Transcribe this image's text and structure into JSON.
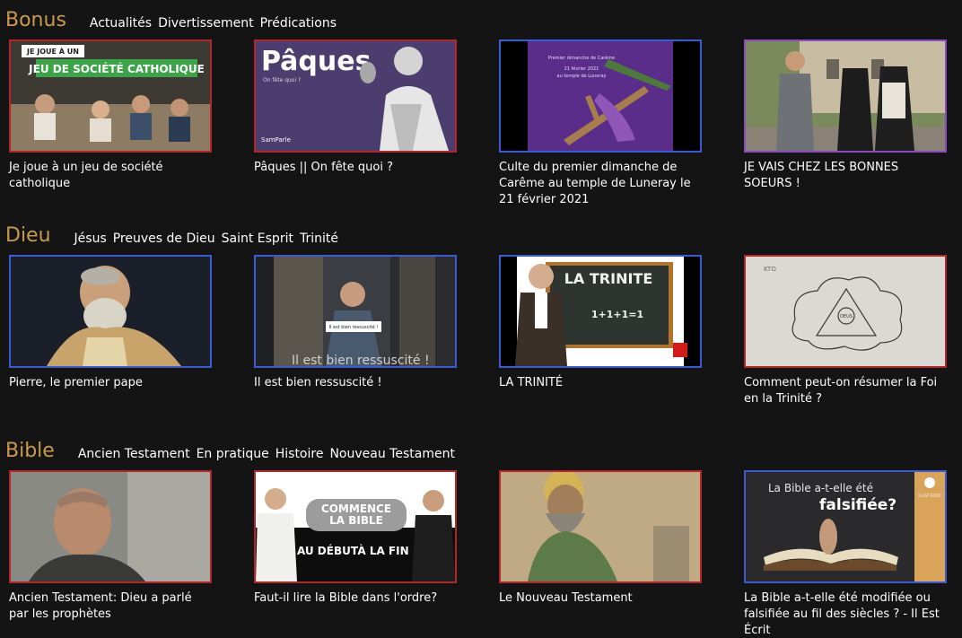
{
  "sections": [
    {
      "title": "Bonus",
      "categories": [
        "Actualités",
        "Divertissement",
        "Prédications"
      ],
      "cards": [
        {
          "title": "Je joue à un jeu de société catholique",
          "thumb_text": [
            "JE JOUE À UN",
            "JEU DE SOCIÉTÉ CATHOLIQUE"
          ]
        },
        {
          "title": "Pâques || On fête quoi ?",
          "thumb_text": [
            "Pâques",
            "On fête quoi ?",
            "SamParle"
          ]
        },
        {
          "title": "Culte du premier dimanche de Carême au temple de Luneray le 21 février 2021",
          "thumb_text": [
            "Premier dimanche de Carême",
            "21 février 2021",
            "au temple de Luneray"
          ]
        },
        {
          "title": "JE VAIS CHEZ LES BONNES SOEURS !",
          "thumb_text": []
        }
      ]
    },
    {
      "title": "Dieu",
      "categories": [
        "Jésus",
        "Preuves de Dieu",
        "Saint Esprit",
        "Trinité"
      ],
      "cards": [
        {
          "title": "Pierre, le premier pape",
          "thumb_text": []
        },
        {
          "title": "Il est bien ressuscité !",
          "thumb_text": [
            "Il est bien ressuscité !",
            "Il est bien ressuscité !"
          ]
        },
        {
          "title": "LA TRINITÉ",
          "thumb_text": [
            "LA TRINITE",
            "1+1+1=1"
          ]
        },
        {
          "title": "Comment peut-on résumer la Foi en la Trinité ?",
          "thumb_text": [
            "KTO",
            "DEUS"
          ]
        }
      ]
    },
    {
      "title": "Bible",
      "categories": [
        "Ancien Testament",
        "En pratique",
        "Histoire",
        "Nouveau Testament"
      ],
      "cards": [
        {
          "title": "Ancien Testament: Dieu a parlé par les prophètes",
          "thumb_text": []
        },
        {
          "title": "Faut-il lire la Bible dans l'ordre?",
          "thumb_text": [
            "COMMENCE",
            "LA BIBLE",
            "AU DÉBUT",
            "À LA FIN"
          ]
        },
        {
          "title": "Le Nouveau Testament",
          "thumb_text": []
        },
        {
          "title": "La Bible a-t-elle été modifiée ou falsifiée au fil des siècles ? - Il Est Écrit",
          "thumb_text": [
            "La Bible a-t-elle été",
            "falsifiée?",
            "IL EST ÉCRIT"
          ]
        }
      ]
    }
  ],
  "colors": {
    "background": "#141414",
    "section_title": "#c89a4a",
    "border_red": "#b3262b",
    "border_blue": "#3b5bd6",
    "border_purple": "#8a4cc4"
  }
}
